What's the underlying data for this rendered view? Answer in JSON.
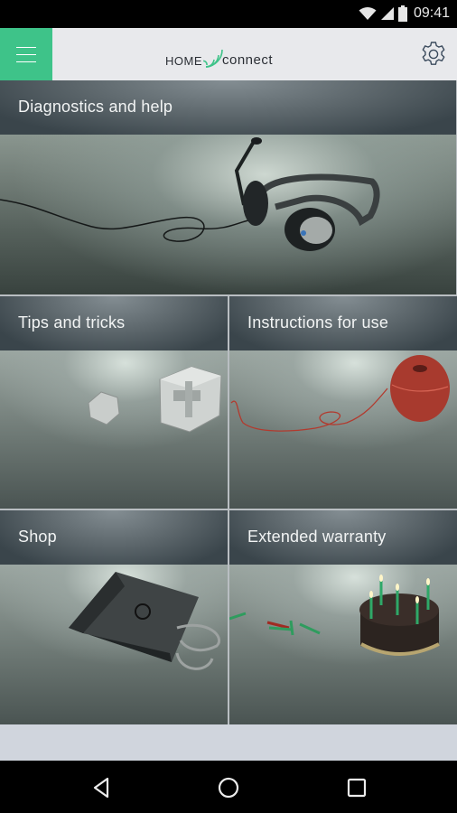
{
  "status_bar": {
    "time": "09:41",
    "icons": [
      "wifi-icon",
      "cell-signal-icon",
      "battery-icon"
    ]
  },
  "app_bar": {
    "menu_icon": "hamburger-menu-icon",
    "logo": {
      "word_left": "home",
      "word_right": "connect",
      "icon": "wireless-waves-icon"
    },
    "settings_icon": "gear-icon",
    "accent_color": "#3ec389"
  },
  "tiles": [
    {
      "id": "diagnostics",
      "title": "Diagnostics and help",
      "image": "headset-photo"
    },
    {
      "id": "tips",
      "title": "Tips and tricks",
      "image": "puzzle-cube-photo"
    },
    {
      "id": "instructions",
      "title": "Instructions for use",
      "image": "ball-of-string-photo"
    },
    {
      "id": "shop",
      "title": "Shop",
      "image": "shopping-bag-photo"
    },
    {
      "id": "warranty",
      "title": "Extended warranty",
      "image": "birthday-cake-photo"
    }
  ],
  "nav_bar": {
    "back_icon": "back-triangle-icon",
    "home_icon": "home-circle-icon",
    "recents_icon": "recents-square-icon"
  }
}
